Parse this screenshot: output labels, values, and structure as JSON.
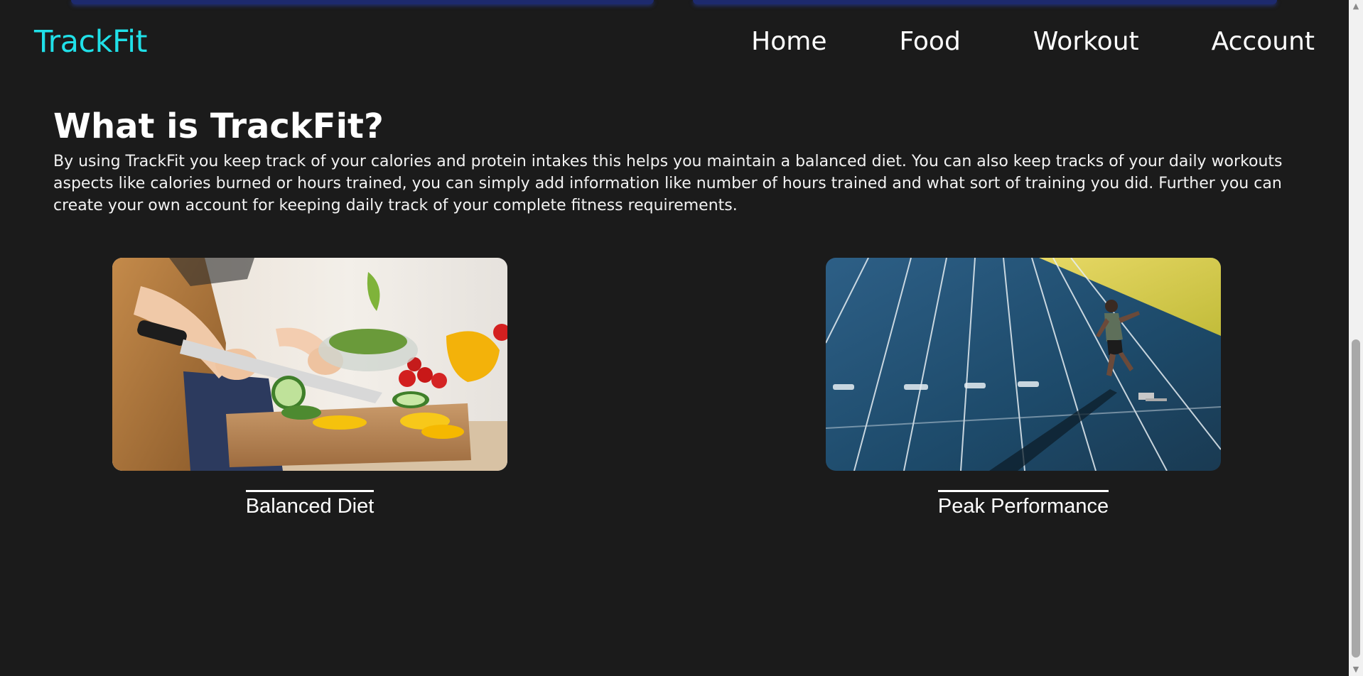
{
  "nav": {
    "logo": "TrackFit",
    "links": [
      "Home",
      "Food",
      "Workout",
      "Account"
    ]
  },
  "about": {
    "title": "What is TrackFit?",
    "body": "By using TrackFit you keep track of your calories and protein intakes this helps you maintain a balanced diet. You can also keep tracks of your daily workouts aspects like calories burned or hours trained, you can simply add information like number of hours trained and what sort of training you did. Further you can create your own account for keeping daily track of your complete fitness requirements."
  },
  "cards": [
    {
      "caption": "Balanced Diet"
    },
    {
      "caption": "Peak Performance"
    }
  ],
  "colors": {
    "background": "#1b1b1b",
    "logo": "#20e0e8",
    "text": "#ffffff"
  }
}
